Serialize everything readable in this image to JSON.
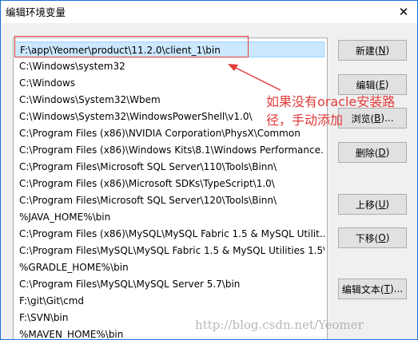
{
  "window": {
    "title": "编辑环境变量",
    "close_glyph": "✕"
  },
  "paths": [
    "F:\\app\\Yeomer\\product\\11.2.0\\client_1\\bin",
    "C:\\Windows\\system32",
    "C:\\Windows",
    "C:\\Windows\\System32\\Wbem",
    "C:\\Windows\\System32\\WindowsPowerShell\\v1.0\\",
    "C:\\Program Files (x86)\\NVIDIA Corporation\\PhysX\\Common",
    "C:\\Program Files (x86)\\Windows Kits\\8.1\\Windows Performance...",
    "C:\\Program Files\\Microsoft SQL Server\\110\\Tools\\Binn\\",
    "C:\\Program Files (x86)\\Microsoft SDKs\\TypeScript\\1.0\\",
    "C:\\Program Files\\Microsoft SQL Server\\120\\Tools\\Binn\\",
    "%JAVA_HOME%\\bin",
    "C:\\Program Files (x86)\\MySQL\\MySQL Fabric 1.5 & MySQL Utilit...",
    "C:\\Program Files\\MySQL\\MySQL Fabric 1.5 & MySQL Utilities 1.5\\",
    "%GRADLE_HOME%\\bin",
    "C:\\Program Files\\MySQL\\MySQL Server 5.7\\bin",
    "F:\\git\\Git\\cmd",
    "F:\\SVN\\bin",
    "%MAVEN_HOME%\\bin"
  ],
  "selected_index": 0,
  "buttons": {
    "new": {
      "label": "新建(",
      "key": "N",
      "suffix": ")"
    },
    "edit": {
      "label": "编辑(",
      "key": "E",
      "suffix": ")"
    },
    "browse": {
      "label": "浏览(",
      "key": "B",
      "suffix": ")..."
    },
    "delete": {
      "label": "删除(",
      "key": "D",
      "suffix": ")"
    },
    "up": {
      "label": "上移(",
      "key": "U",
      "suffix": ")"
    },
    "down": {
      "label": "下移(",
      "key": "O",
      "suffix": ")"
    },
    "edit_text": {
      "label": "编辑文本(",
      "key": "T",
      "suffix": ")..."
    }
  },
  "annotation": {
    "text": "如果没有oracle安装路径，手动添加",
    "color": "#e33a3a"
  },
  "watermark": "http://blog.csdn.net/Yeomer",
  "colors": {
    "selection_bg": "#cce8ff",
    "selection_border": "#99d1ff",
    "window_border": "#1a6fd0",
    "button_bg": "#e1e1e1"
  }
}
